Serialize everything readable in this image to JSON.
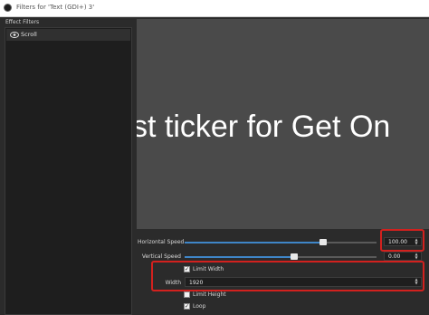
{
  "window": {
    "title": "Filters for 'Text (GDI+) 3'"
  },
  "effect_filters": {
    "label": "Effect Filters",
    "items": [
      {
        "name": "Scroll",
        "visible": true
      }
    ]
  },
  "preview": {
    "text": "st ticker for Get On"
  },
  "properties": {
    "horizontal_speed": {
      "label": "Horizontal Speed",
      "value": "100.00",
      "slider_fraction": 0.72
    },
    "vertical_speed": {
      "label": "Vertical Speed",
      "value": "0.00",
      "slider_fraction": 0.57
    },
    "limit_width": {
      "label": "Limit Width",
      "checked": true
    },
    "width": {
      "label": "Width",
      "value": "1920"
    },
    "limit_height": {
      "label": "Limit Height",
      "checked": false
    },
    "loop": {
      "label": "Loop",
      "checked": true
    }
  },
  "colors": {
    "accent": "#3f86c8",
    "highlight": "#d2211e",
    "background": "#2b2b2b",
    "preview": "#4a4a4a"
  }
}
